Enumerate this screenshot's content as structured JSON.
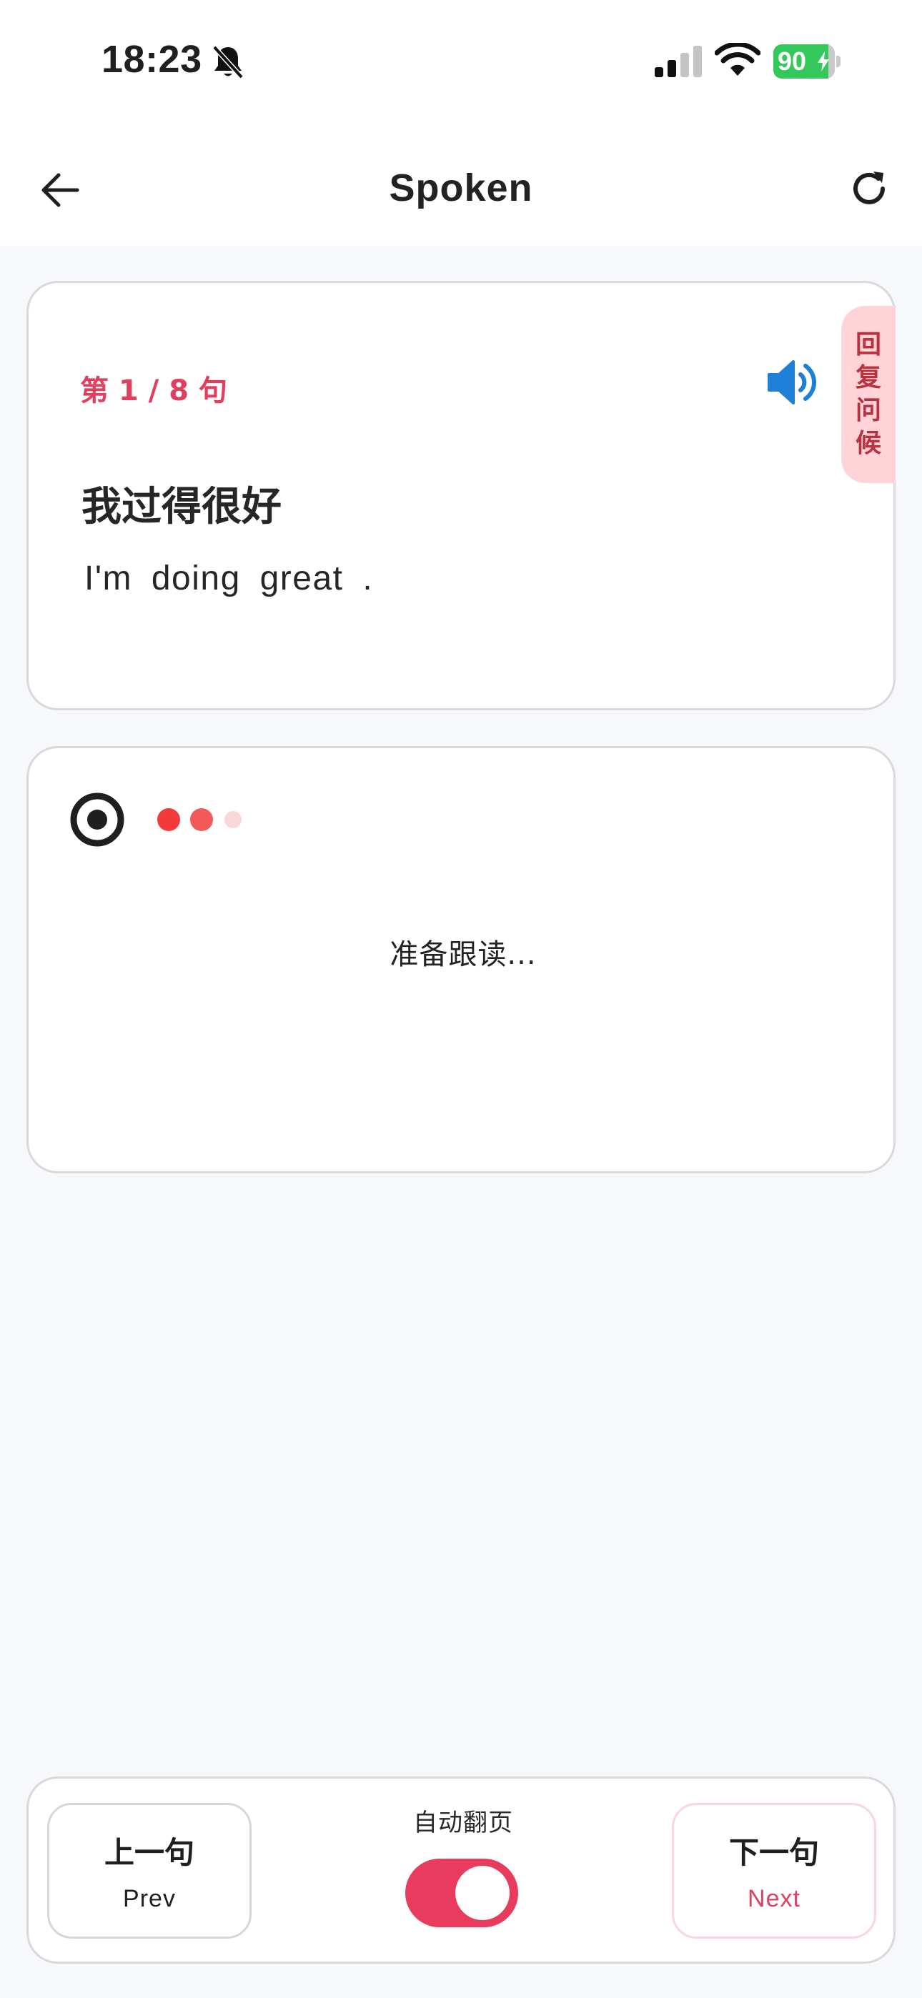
{
  "status_bar": {
    "time": "18:23",
    "battery_percent": "90",
    "battery_level": 0.9,
    "icons": [
      "bell-slash-icon",
      "cellular-signal-icon",
      "wifi-icon",
      "battery-charging-icon"
    ]
  },
  "nav": {
    "title": "Spoken",
    "back_icon": "arrow-left-icon",
    "refresh_icon": "refresh-icon"
  },
  "sentence_card": {
    "progress": "第 1 / 8 句",
    "category": [
      "回",
      "复",
      "问",
      "候"
    ],
    "zh": "我过得很好",
    "en": "I'm doing great .",
    "speaker_icon": "speaker-volume-icon",
    "accent_color": "#e0405e"
  },
  "record_card": {
    "status": "准备跟读...",
    "mic_icon": "target-icon",
    "dot_colors": [
      "#f23a3a",
      "#f25a5a",
      "#fbd6d6"
    ]
  },
  "controls": {
    "prev": {
      "zh": "上一句",
      "en": "Prev"
    },
    "next": {
      "zh": "下一句",
      "en": "Next"
    },
    "auto_flip_label": "自动翻页",
    "auto_flip_on": true,
    "toggle_color": "#e83b5e"
  }
}
